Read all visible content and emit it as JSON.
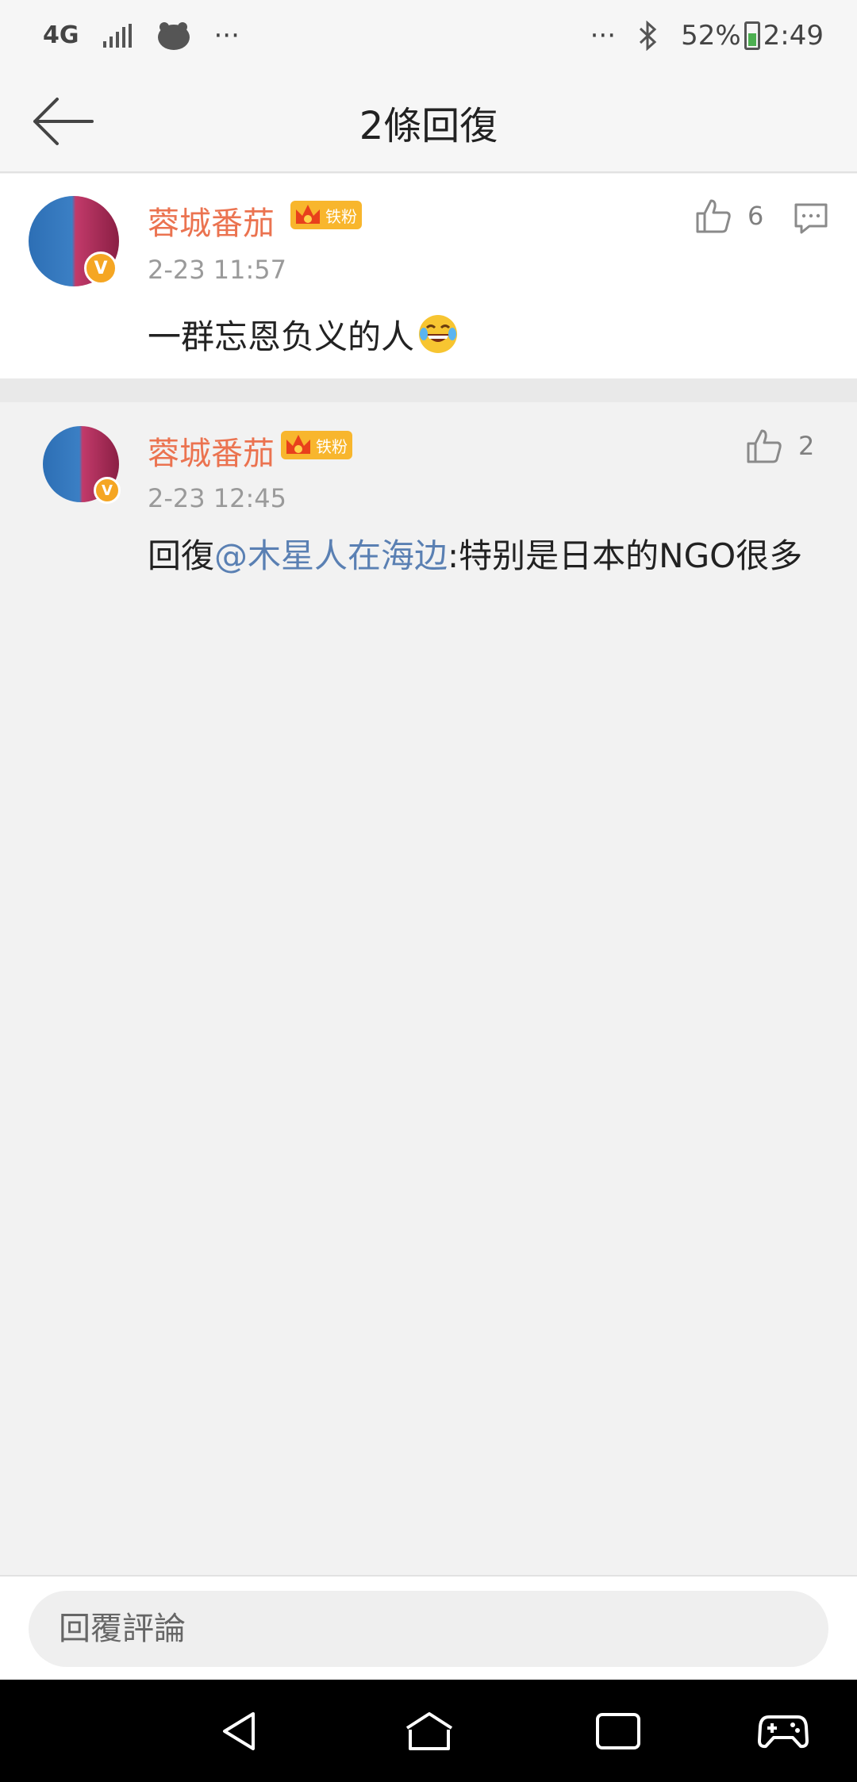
{
  "status_bar": {
    "network": "4G",
    "more_left": "···",
    "more_right": "···",
    "battery": "52%",
    "time": "2:49"
  },
  "header": {
    "title": "2條回復"
  },
  "main_comment": {
    "username": "蓉城番茄",
    "badge": "铁粉",
    "time": "2-23 11:57",
    "content": "一群忘恩负义的人",
    "likes": "6",
    "verified_mark": "V"
  },
  "reply": {
    "username": "蓉城番茄",
    "badge": "铁粉",
    "time": "2-23 12:45",
    "prefix": "回復",
    "mention": "@木星人在海边",
    "text": ":特别是日本的NGO很多",
    "likes": "2",
    "verified_mark": "V"
  },
  "input": {
    "placeholder": "回覆評論"
  },
  "colors": {
    "username": "#eb7350",
    "mention": "#5a80b3",
    "badge": "#f8b62d",
    "verified": "#f5a623"
  }
}
